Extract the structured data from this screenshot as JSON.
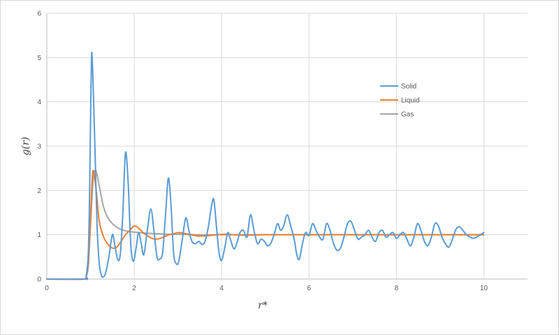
{
  "chart_data": {
    "type": "line",
    "title": "",
    "xlabel": "r*",
    "ylabel": "g(r)",
    "xlim": [
      0,
      11
    ],
    "ylim": [
      0,
      6
    ],
    "x_ticks": [
      0,
      2,
      4,
      6,
      8,
      10
    ],
    "y_ticks": [
      0,
      1,
      2,
      3,
      4,
      5,
      6
    ],
    "grid": true,
    "legend_position": "right-upper",
    "series": [
      {
        "name": "Solid",
        "color": "#5b9bd5",
        "points": [
          [
            0.0,
            0.0
          ],
          [
            0.85,
            0.0
          ],
          [
            0.9,
            0.05
          ],
          [
            0.95,
            0.6
          ],
          [
            0.98,
            2.0
          ],
          [
            1.02,
            4.9
          ],
          [
            1.05,
            4.7
          ],
          [
            1.1,
            3.0
          ],
          [
            1.15,
            1.2
          ],
          [
            1.2,
            0.35
          ],
          [
            1.25,
            0.08
          ],
          [
            1.3,
            0.05
          ],
          [
            1.35,
            0.15
          ],
          [
            1.42,
            0.5
          ],
          [
            1.5,
            1.0
          ],
          [
            1.55,
            0.8
          ],
          [
            1.62,
            0.45
          ],
          [
            1.68,
            0.55
          ],
          [
            1.74,
            1.5
          ],
          [
            1.8,
            2.85
          ],
          [
            1.86,
            2.2
          ],
          [
            1.92,
            0.8
          ],
          [
            1.98,
            0.4
          ],
          [
            2.05,
            0.75
          ],
          [
            2.1,
            1.05
          ],
          [
            2.16,
            0.8
          ],
          [
            2.22,
            0.55
          ],
          [
            2.3,
            1.1
          ],
          [
            2.38,
            1.58
          ],
          [
            2.45,
            1.1
          ],
          [
            2.52,
            0.5
          ],
          [
            2.58,
            0.45
          ],
          [
            2.65,
            0.6
          ],
          [
            2.72,
            1.5
          ],
          [
            2.78,
            2.28
          ],
          [
            2.84,
            1.7
          ],
          [
            2.9,
            0.6
          ],
          [
            2.96,
            0.35
          ],
          [
            3.02,
            0.4
          ],
          [
            3.1,
            0.9
          ],
          [
            3.18,
            1.38
          ],
          [
            3.25,
            1.1
          ],
          [
            3.32,
            0.85
          ],
          [
            3.4,
            0.8
          ],
          [
            3.48,
            0.85
          ],
          [
            3.55,
            0.78
          ],
          [
            3.62,
            0.85
          ],
          [
            3.7,
            1.2
          ],
          [
            3.76,
            1.6
          ],
          [
            3.82,
            1.8
          ],
          [
            3.88,
            1.2
          ],
          [
            3.94,
            0.6
          ],
          [
            4.0,
            0.42
          ],
          [
            4.08,
            0.75
          ],
          [
            4.14,
            1.05
          ],
          [
            4.2,
            0.9
          ],
          [
            4.28,
            0.68
          ],
          [
            4.35,
            0.82
          ],
          [
            4.42,
            1.05
          ],
          [
            4.5,
            1.1
          ],
          [
            4.58,
            0.95
          ],
          [
            4.66,
            1.45
          ],
          [
            4.74,
            1.1
          ],
          [
            4.82,
            0.8
          ],
          [
            4.9,
            0.9
          ],
          [
            4.98,
            0.85
          ],
          [
            5.05,
            0.75
          ],
          [
            5.12,
            0.8
          ],
          [
            5.2,
            1.0
          ],
          [
            5.28,
            1.25
          ],
          [
            5.35,
            1.1
          ],
          [
            5.42,
            1.2
          ],
          [
            5.5,
            1.45
          ],
          [
            5.58,
            1.2
          ],
          [
            5.66,
            0.9
          ],
          [
            5.72,
            0.55
          ],
          [
            5.78,
            0.45
          ],
          [
            5.85,
            0.8
          ],
          [
            5.92,
            1.05
          ],
          [
            6.0,
            0.98
          ],
          [
            6.08,
            1.25
          ],
          [
            6.16,
            1.1
          ],
          [
            6.24,
            0.95
          ],
          [
            6.32,
            0.9
          ],
          [
            6.4,
            1.25
          ],
          [
            6.48,
            1.1
          ],
          [
            6.56,
            0.8
          ],
          [
            6.64,
            0.65
          ],
          [
            6.72,
            0.7
          ],
          [
            6.8,
            0.95
          ],
          [
            6.88,
            1.25
          ],
          [
            6.96,
            1.3
          ],
          [
            7.04,
            1.1
          ],
          [
            7.12,
            0.9
          ],
          [
            7.2,
            0.95
          ],
          [
            7.28,
            1.0
          ],
          [
            7.36,
            1.1
          ],
          [
            7.44,
            0.95
          ],
          [
            7.52,
            0.85
          ],
          [
            7.6,
            1.05
          ],
          [
            7.68,
            1.1
          ],
          [
            7.76,
            0.95
          ],
          [
            7.84,
            1.0
          ],
          [
            7.92,
            1.05
          ],
          [
            8.0,
            0.92
          ],
          [
            8.08,
            1.0
          ],
          [
            8.16,
            1.05
          ],
          [
            8.24,
            0.9
          ],
          [
            8.32,
            0.75
          ],
          [
            8.4,
            0.95
          ],
          [
            8.48,
            1.25
          ],
          [
            8.56,
            1.1
          ],
          [
            8.64,
            0.85
          ],
          [
            8.72,
            0.75
          ],
          [
            8.8,
            0.95
          ],
          [
            8.88,
            1.25
          ],
          [
            8.96,
            1.2
          ],
          [
            9.04,
            0.95
          ],
          [
            9.12,
            0.8
          ],
          [
            9.2,
            0.72
          ],
          [
            9.28,
            0.9
          ],
          [
            9.36,
            1.12
          ],
          [
            9.44,
            1.18
          ],
          [
            9.52,
            1.1
          ],
          [
            9.6,
            1.0
          ],
          [
            9.68,
            0.95
          ],
          [
            9.76,
            0.92
          ],
          [
            9.84,
            0.95
          ],
          [
            9.92,
            1.0
          ],
          [
            10.0,
            1.05
          ]
        ]
      },
      {
        "name": "Liquid",
        "color": "#ed7d31",
        "points": [
          [
            0.0,
            0.0
          ],
          [
            0.85,
            0.0
          ],
          [
            0.9,
            0.08
          ],
          [
            0.95,
            0.4
          ],
          [
            1.0,
            1.4
          ],
          [
            1.05,
            2.4
          ],
          [
            1.1,
            2.25
          ],
          [
            1.15,
            1.8
          ],
          [
            1.2,
            1.3
          ],
          [
            1.3,
            0.95
          ],
          [
            1.4,
            0.78
          ],
          [
            1.5,
            0.7
          ],
          [
            1.6,
            0.72
          ],
          [
            1.7,
            0.85
          ],
          [
            1.8,
            1.0
          ],
          [
            1.9,
            1.1
          ],
          [
            2.0,
            1.2
          ],
          [
            2.1,
            1.15
          ],
          [
            2.2,
            1.05
          ],
          [
            2.3,
            0.98
          ],
          [
            2.4,
            0.92
          ],
          [
            2.5,
            0.9
          ],
          [
            2.6,
            0.92
          ],
          [
            2.7,
            0.96
          ],
          [
            2.8,
            1.0
          ],
          [
            2.9,
            1.02
          ],
          [
            3.0,
            1.05
          ],
          [
            3.1,
            1.04
          ],
          [
            3.2,
            1.02
          ],
          [
            3.3,
            1.0
          ],
          [
            3.4,
            0.98
          ],
          [
            3.5,
            0.97
          ],
          [
            3.7,
            0.98
          ],
          [
            3.9,
            1.0
          ],
          [
            4.1,
            1.01
          ],
          [
            4.3,
            1.0
          ],
          [
            4.6,
            0.99
          ],
          [
            5.0,
            1.0
          ],
          [
            6.0,
            1.0
          ],
          [
            7.0,
            1.0
          ],
          [
            8.0,
            1.0
          ],
          [
            9.0,
            1.0
          ],
          [
            10.0,
            1.0
          ]
        ]
      },
      {
        "name": "Gas",
        "color": "#a5a5a5",
        "points": [
          [
            0.0,
            0.0
          ],
          [
            0.85,
            0.0
          ],
          [
            0.9,
            0.05
          ],
          [
            0.95,
            0.3
          ],
          [
            1.0,
            1.2
          ],
          [
            1.05,
            2.1
          ],
          [
            1.1,
            2.45
          ],
          [
            1.15,
            2.35
          ],
          [
            1.2,
            2.1
          ],
          [
            1.25,
            1.85
          ],
          [
            1.3,
            1.62
          ],
          [
            1.4,
            1.38
          ],
          [
            1.5,
            1.25
          ],
          [
            1.6,
            1.17
          ],
          [
            1.7,
            1.12
          ],
          [
            1.8,
            1.09
          ],
          [
            1.9,
            1.07
          ],
          [
            2.0,
            1.06
          ],
          [
            2.2,
            1.04
          ],
          [
            2.4,
            1.03
          ],
          [
            2.6,
            1.02
          ],
          [
            2.8,
            1.01
          ],
          [
            3.0,
            1.01
          ],
          [
            3.5,
            1.0
          ],
          [
            4.0,
            1.0
          ],
          [
            5.0,
            1.0
          ],
          [
            6.0,
            1.0
          ],
          [
            7.0,
            1.0
          ],
          [
            8.0,
            1.0
          ],
          [
            9.0,
            1.0
          ],
          [
            10.0,
            1.0
          ]
        ]
      }
    ]
  }
}
